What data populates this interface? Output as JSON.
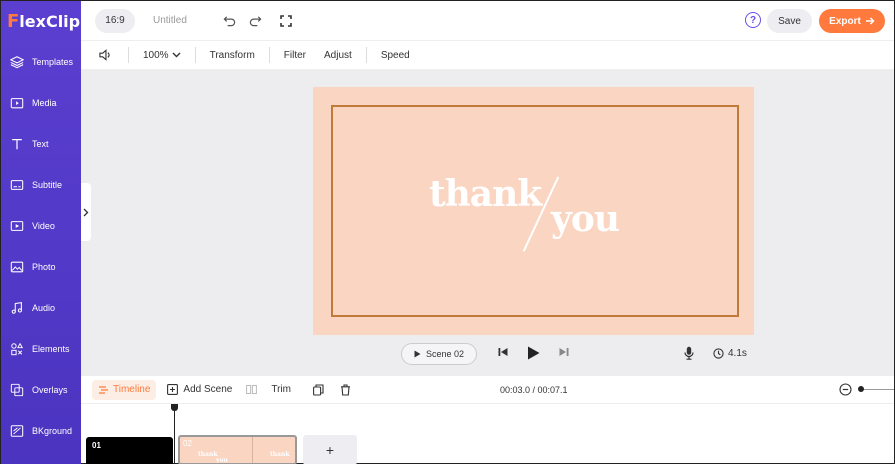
{
  "app": {
    "logo_first": "F",
    "logo_rest": "lexClip",
    "aspect_ratio": "16:9",
    "project_title": "Untitled",
    "save_label": "Save",
    "export_label": "Export",
    "help_glyph": "?",
    "brand_color": "#5b3fd0",
    "accent_color": "#ff7a3c"
  },
  "sidebar": {
    "items": [
      {
        "label": "Templates",
        "icon": "layers-icon"
      },
      {
        "label": "Media",
        "icon": "media-folder-icon"
      },
      {
        "label": "Text",
        "icon": "text-icon"
      },
      {
        "label": "Subtitle",
        "icon": "subtitle-icon"
      },
      {
        "label": "Video",
        "icon": "video-icon"
      },
      {
        "label": "Photo",
        "icon": "photo-icon"
      },
      {
        "label": "Audio",
        "icon": "music-icon"
      },
      {
        "label": "Elements",
        "icon": "elements-icon"
      },
      {
        "label": "Overlays",
        "icon": "overlays-icon"
      },
      {
        "label": "BKground",
        "icon": "background-icon"
      }
    ]
  },
  "toolbar": {
    "zoom": "100%",
    "transform": "Transform",
    "filter": "Filter",
    "adjust": "Adjust",
    "speed": "Speed"
  },
  "canvas": {
    "word1": "thank",
    "word2": "you",
    "slide_color": "#fad5c1"
  },
  "player": {
    "scene_label": "Scene 02",
    "duration": "4.1s"
  },
  "timeline": {
    "tab_label": "Timeline",
    "add_scene": "Add Scene",
    "trim": "Trim",
    "time": "00:03.0 / 00:07.1",
    "clips": [
      {
        "number": "01"
      },
      {
        "number": "02",
        "thumb_text_a": "thank",
        "thumb_text_b": "you"
      }
    ],
    "add_tile": "+"
  }
}
